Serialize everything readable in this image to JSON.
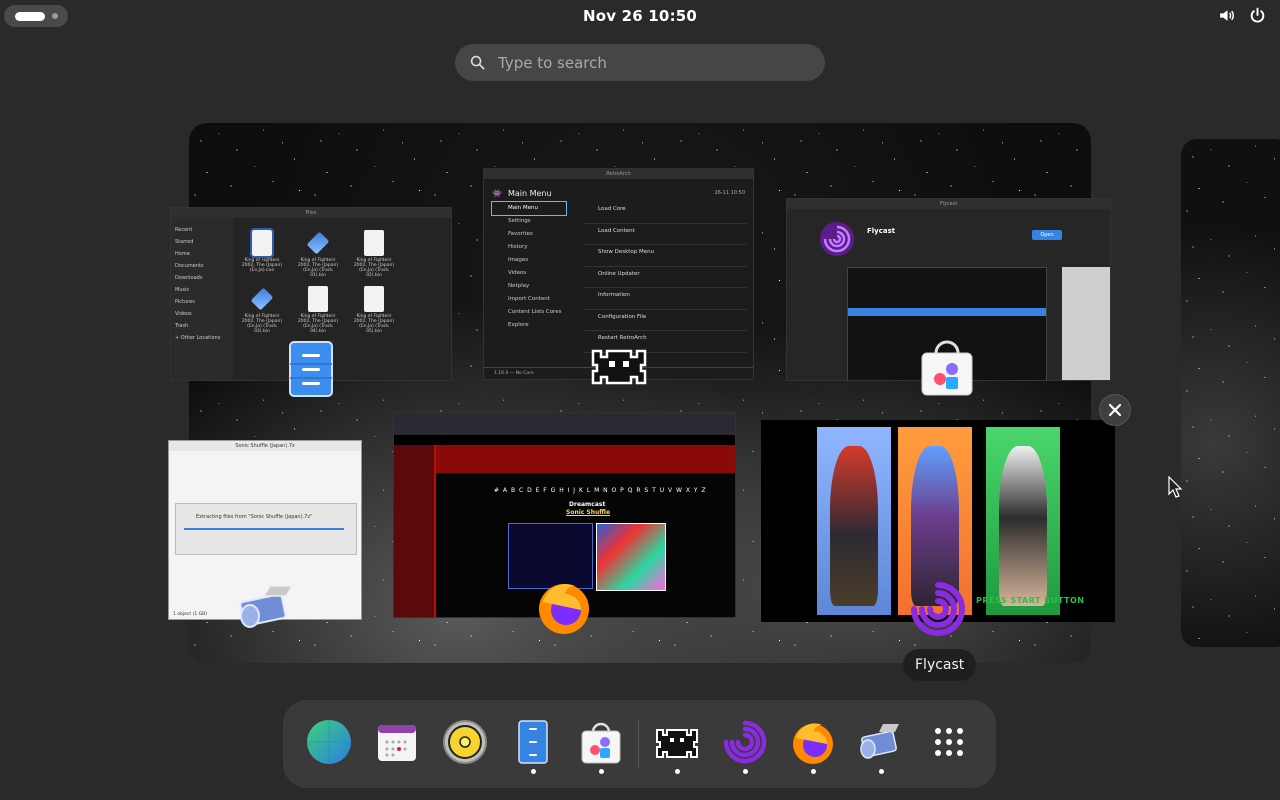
{
  "topbar": {
    "clock": "Nov 26  10:50"
  },
  "search": {
    "placeholder": "Type to search"
  },
  "windows": {
    "files": {
      "title": "Files",
      "sidebar": [
        "Recent",
        "Starred",
        "Home",
        "Documents",
        "Downloads",
        "Music",
        "Pictures",
        "Videos",
        "Trash",
        "+ Other Locations"
      ],
      "items": [
        "King of Fighters 2002, The (Japan) (En,Ja).cue",
        "King of Fighters 2002, The (Japan) (En,Ja) (Track 01).bin",
        "King of Fighters 2002, The (Japan) (En,Ja) (Track 02).bin",
        "King of Fighters 2002, The (Japan) (En,Ja) (Track 03).bin",
        "King of Fighters 2002, The (Japan) (En,Ja) (Track 04).bin",
        "King of Fighters 2002, The (Japan) (En,Ja) (Track 05).bin"
      ]
    },
    "retroarch": {
      "title": "RetroArch",
      "menu_title": "Main Menu",
      "time": "26-11 10:50",
      "left_menu": [
        "Main Menu",
        "Settings",
        "Favorites",
        "History",
        "Images",
        "Videos",
        "Netplay",
        "Import Content",
        "Content Lists Cores",
        "Explore"
      ],
      "right_menu": [
        "Load Core",
        "Load Content",
        "Show Desktop Menu",
        "Online Updater",
        "Information",
        "Configuration File",
        "Restart RetroArch"
      ],
      "footer": "1.16.0 — No Core"
    },
    "software": {
      "title": "Flycast",
      "app_name": "Flycast",
      "install_label": "Open"
    },
    "roller": {
      "title": "Sonic Shuffle (Japan).7z",
      "dialog_text": "Extracting files from \"Sonic Shuffle (Japan).7z\"",
      "status": "1 object (1 GB)"
    },
    "firefox": {
      "alphabet": "# A B C D E F G H I J K L M N O P Q R S T U V W X Y Z",
      "heading": "Dreamcast",
      "subheading": "Sonic Shuffle"
    },
    "kof": {
      "press_start": "PRESS START BUTTON"
    }
  },
  "tooltip": {
    "label": "Flycast"
  },
  "dock": {
    "items": [
      {
        "name": "browser-globe",
        "running": false
      },
      {
        "name": "calendar",
        "running": false
      },
      {
        "name": "rhythmbox",
        "running": false
      },
      {
        "name": "files",
        "running": true
      },
      {
        "name": "software",
        "running": true
      },
      {
        "name": "retroarch",
        "running": true
      },
      {
        "name": "flycast",
        "running": true
      },
      {
        "name": "firefox",
        "running": true
      },
      {
        "name": "file-roller",
        "running": true
      },
      {
        "name": "app-grid",
        "running": false
      }
    ]
  }
}
